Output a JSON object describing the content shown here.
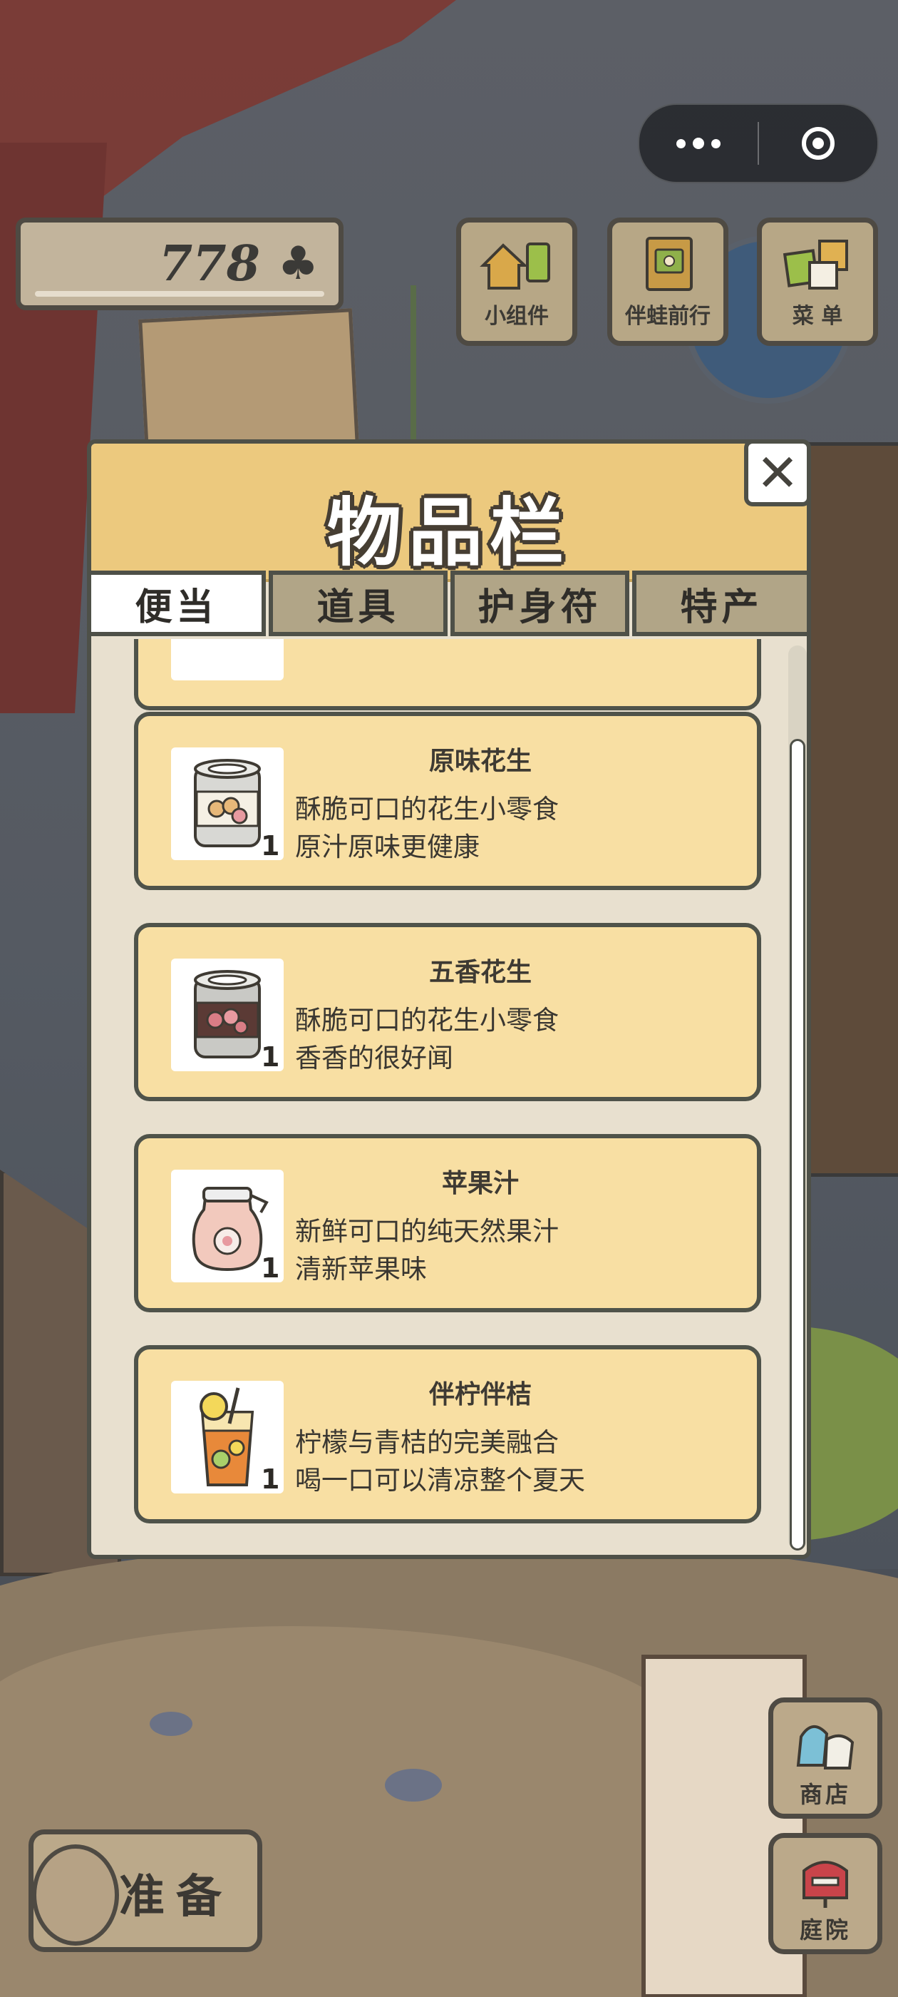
{
  "hud": {
    "clover_count": "778",
    "clover_icon": "♣"
  },
  "top_buttons": {
    "widget_label": "小组件",
    "frog_label": "伴蛙前行",
    "menu_label": "菜 单"
  },
  "inventory": {
    "title": "物品栏",
    "close_symbol": "✕",
    "tabs": [
      {
        "label": "便当",
        "active": true
      },
      {
        "label": "道具",
        "active": false
      },
      {
        "label": "护身符",
        "active": false
      },
      {
        "label": "特产",
        "active": false
      }
    ],
    "items": [
      {
        "name": "原味花生",
        "line1": "酥脆可口的花生小零食",
        "line2": "原汁原味更健康",
        "qty": "1",
        "icon": "peanut-can-icon"
      },
      {
        "name": "五香花生",
        "line1": "酥脆可口的花生小零食",
        "line2": "香香的很好闻",
        "qty": "1",
        "icon": "spiced-peanut-can-icon"
      },
      {
        "name": "苹果汁",
        "line1": "新鲜可口的纯天然果汁",
        "line2": "清新苹果味",
        "qty": "1",
        "icon": "apple-juice-jar-icon"
      },
      {
        "name": "伴柠伴桔",
        "line1": "柠檬与青桔的完美融合",
        "line2": "喝一口可以清凉整个夏天",
        "qty": "1",
        "icon": "lemon-drink-glass-icon"
      }
    ]
  },
  "bottom": {
    "prepare_label": "准备",
    "shop_label": "商店",
    "yard_label": "庭院"
  },
  "colors": {
    "panel_header": "#ecc97e",
    "item_card": "#f8dfa3",
    "outline": "#4e5048"
  }
}
